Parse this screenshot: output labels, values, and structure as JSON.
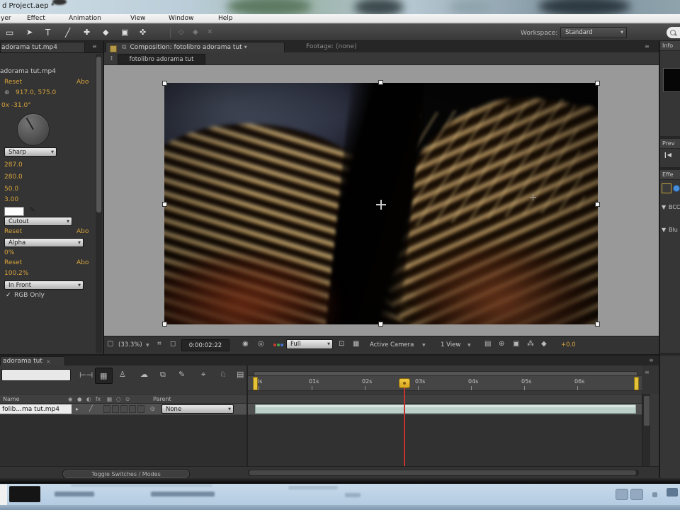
{
  "colors": {
    "accent_orange": "#d6a33c",
    "layer_bar_teal": "#bccfc9",
    "cti_red": "#c5342c",
    "work_area_yellow": "#e3c139"
  },
  "title_bar": {
    "title": "d Project.aep *"
  },
  "menu": {
    "items": [
      "yer",
      "Effect",
      "Animation",
      "View",
      "Window",
      "Help"
    ]
  },
  "toolbar": {
    "tools": [
      "▭",
      "➤",
      "T",
      "╱",
      "✚",
      "◆",
      "▣",
      "✜"
    ],
    "tools_disabled": [
      "◇",
      "◆",
      "✕"
    ],
    "workspace_label": "Workspace:",
    "workspace_value": "Standard"
  },
  "effect_controls": {
    "tab": "adorama tut.mp4",
    "source_name": "adorama tut.mp4",
    "reset": "Reset",
    "about": "Abo",
    "point_value": "917.0, 575.0",
    "angle_value": "0x -31.0°",
    "render_dropdown": "Sharp",
    "values": [
      "287.0",
      "280.0",
      "50.0",
      "3.00"
    ],
    "backing_dropdown": "Cutout",
    "channel_dropdown": "Alpha",
    "percent_value": "0%",
    "opacity_value": "100.2%",
    "order_dropdown": "In Front",
    "checkmark": "✓",
    "rgb_only_label": "RGB Only"
  },
  "composition": {
    "tab_active": "Composition: fotolibro adorama tut",
    "tab_inactive": "Footage: (none)",
    "breadcrumb_button": "fotolibro adorama tut",
    "magnification": "(33.3%)",
    "timecode": "0:00:02:22",
    "resolution": "Full",
    "camera_dropdown": "Active Camera",
    "view_dropdown": "1 View",
    "exposure": "+0.0"
  },
  "timeline": {
    "tab": "adorama tut",
    "close_glyph": "×",
    "ruler_labels": [
      "0s",
      "01s",
      "02s",
      "03s",
      "04s",
      "05s",
      "06s"
    ],
    "name_column": "Name",
    "parent_column": "Parent",
    "layer_name": "folib...ma tut.mp4",
    "parent_value": "None",
    "toggle_button": "Toggle Switches / Modes"
  },
  "right_dock": {
    "info_title": "Info",
    "preview_title": "Prev",
    "effects_title": "Effe",
    "prev_glyph": "❙◀",
    "tri": "▼",
    "item1": "BCC",
    "item2": "Blu"
  },
  "icons": {
    "panel_menu": "≡",
    "caret": "▼",
    "crosshair": "⊕",
    "eyedropper": "✐",
    "comp_tab_icon": "⧉",
    "breadcrumb_icon": "↥",
    "comp_left": [
      "▢",
      "⌗",
      "◻"
    ],
    "snapshot": "◉",
    "channel_dot": "◎",
    "roi": "⊡",
    "grid": "▦",
    "view_icons": [
      "▤",
      "⊕",
      "▣",
      "⁂",
      "◆"
    ],
    "tl_tools": [
      "⊢⊣",
      "▦",
      "♙",
      "☁",
      "⧉",
      "✎",
      "⌖",
      "♘",
      "▤"
    ],
    "switch_header": [
      "◉",
      "●",
      "◐",
      "fx",
      "▦",
      "○",
      "⊙"
    ],
    "layer_twirl": "▸",
    "layer_fx": "╱",
    "pickwhip": "◎"
  }
}
